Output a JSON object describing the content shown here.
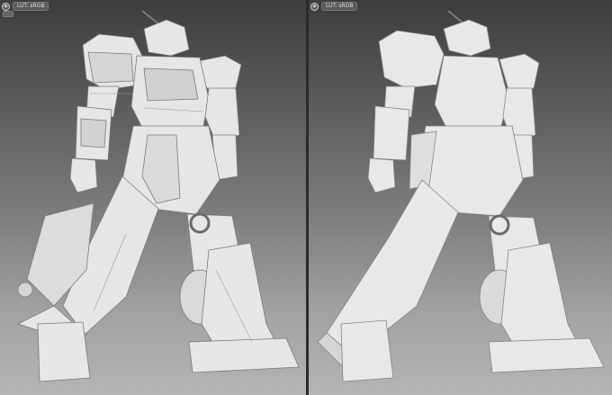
{
  "viewports": [
    {
      "id": "left",
      "icon_name": "eye-icon",
      "label": "LUT: sRGB",
      "model": "mecha-robot-render-detailed"
    },
    {
      "id": "right",
      "icon_name": "eye-icon",
      "label": "LUT: sRGB",
      "model": "mecha-robot-render-smooth"
    }
  ],
  "colors": {
    "model_base": "#e6e6e6",
    "model_shadow": "#b5b5b5",
    "model_dark": "#7b7b7b",
    "bg_top": "#3d3d3d",
    "bg_bottom": "#b4b4b4",
    "divider": "#2b2b2b"
  }
}
